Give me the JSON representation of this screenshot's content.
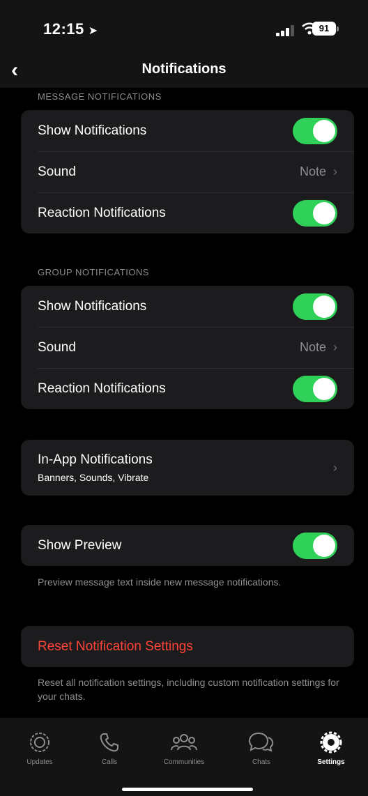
{
  "status": {
    "time": "12:15",
    "battery": "91"
  },
  "nav": {
    "back_label": "‹",
    "title": "Notifications"
  },
  "message_section": {
    "header": "MESSAGE NOTIFICATIONS",
    "show_label": "Show Notifications",
    "sound_label": "Sound",
    "sound_value": "Note",
    "reaction_label": "Reaction Notifications"
  },
  "group_section": {
    "header": "GROUP NOTIFICATIONS",
    "show_label": "Show Notifications",
    "sound_label": "Sound",
    "sound_value": "Note",
    "reaction_label": "Reaction Notifications"
  },
  "in_app": {
    "label": "In-App Notifications",
    "subtitle": "Banners, Sounds, Vibrate"
  },
  "preview": {
    "label": "Show Preview",
    "footnote": "Preview message text inside new message notifications."
  },
  "reset": {
    "label": "Reset Notification Settings",
    "footnote": "Reset all notification settings, including custom notification settings for your chats."
  },
  "tabs": [
    {
      "label": "Updates"
    },
    {
      "label": "Calls"
    },
    {
      "label": "Communities"
    },
    {
      "label": "Chats"
    },
    {
      "label": "Settings"
    }
  ],
  "colors": {
    "toggle_on": "#30d158",
    "destructive": "#ff453a"
  }
}
